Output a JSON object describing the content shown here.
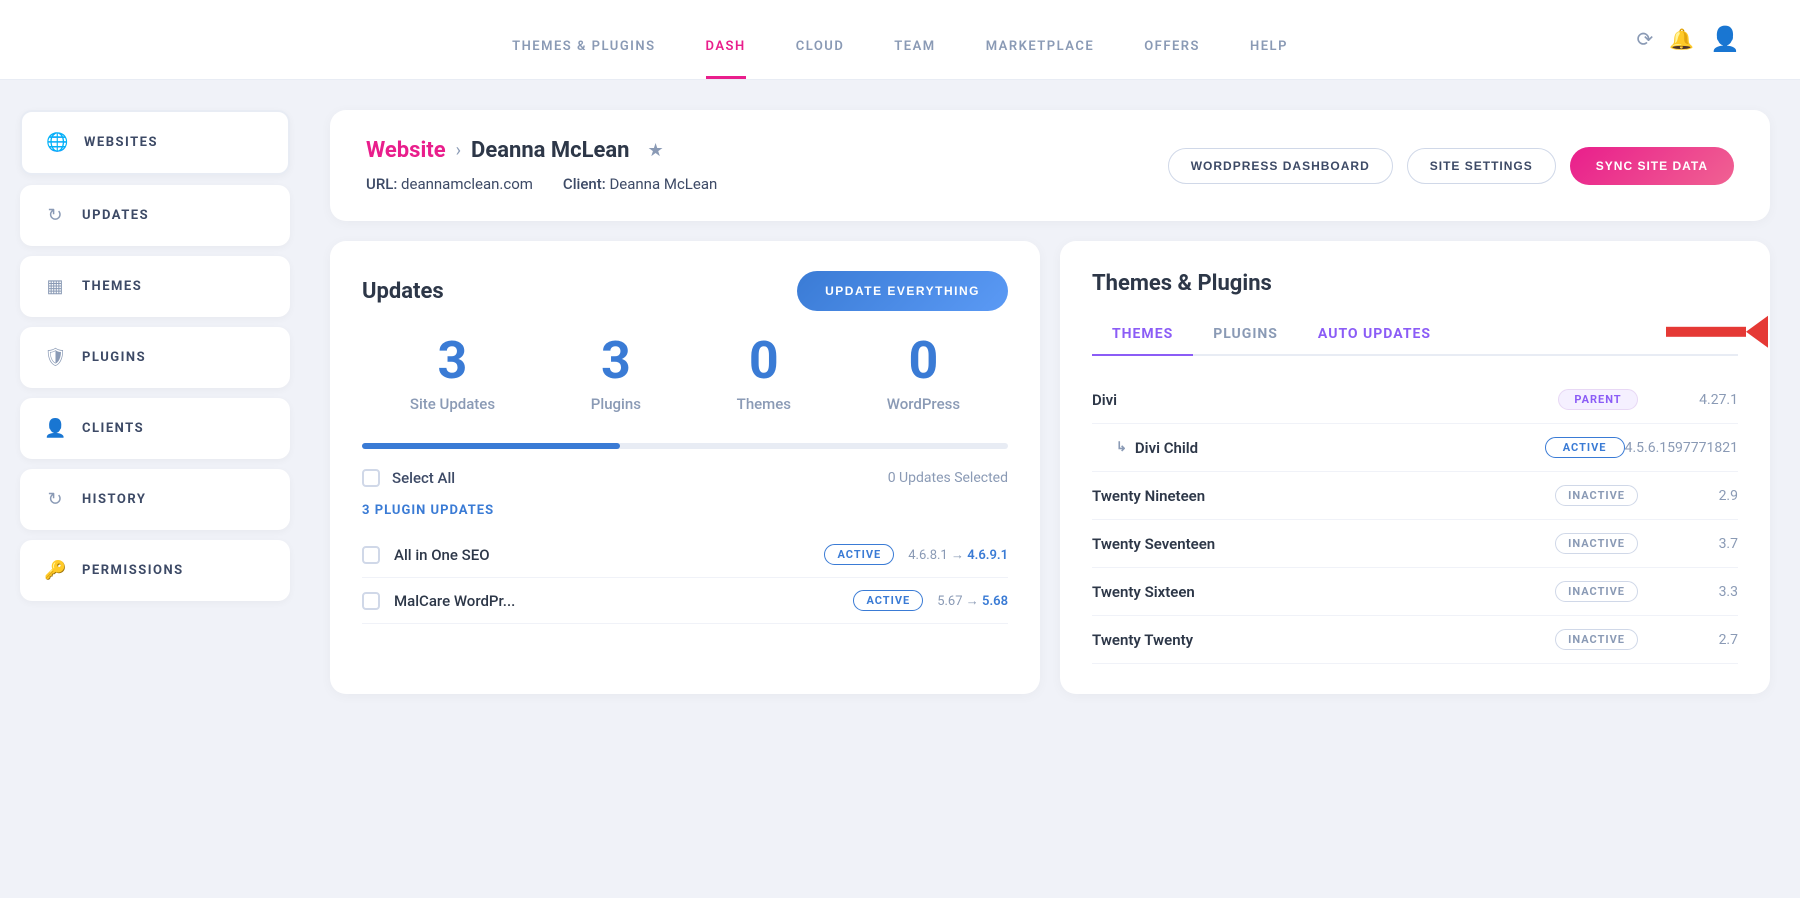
{
  "topNav": {
    "links": [
      {
        "id": "themes-plugins",
        "label": "THEMES & PLUGINS",
        "active": false
      },
      {
        "id": "dash",
        "label": "DASH",
        "active": true
      },
      {
        "id": "cloud",
        "label": "CLOUD",
        "active": false
      },
      {
        "id": "team",
        "label": "TEAM",
        "active": false
      },
      {
        "id": "marketplace",
        "label": "MARKETPLACE",
        "active": false
      },
      {
        "id": "offers",
        "label": "OFFERS",
        "active": false
      },
      {
        "id": "help",
        "label": "HELP",
        "active": false
      }
    ]
  },
  "sidebar": {
    "items": [
      {
        "id": "websites",
        "label": "WEBSITES",
        "icon": "🌐",
        "active": true
      },
      {
        "id": "updates",
        "label": "UPDATES",
        "icon": "↻",
        "active": false
      },
      {
        "id": "themes",
        "label": "THEMES",
        "icon": "▦",
        "active": false
      },
      {
        "id": "plugins",
        "label": "PLUGINS",
        "icon": "🛡",
        "active": false
      },
      {
        "id": "clients",
        "label": "CLIENTS",
        "icon": "👤",
        "active": false
      },
      {
        "id": "history",
        "label": "HISTORY",
        "icon": "↻",
        "active": false
      },
      {
        "id": "permissions",
        "label": "PERMISSIONS",
        "icon": "🔑",
        "active": false
      }
    ]
  },
  "siteHeader": {
    "breadcrumb_website": "Website",
    "breadcrumb_arrow": "›",
    "site_name": "Deanna McLean",
    "url_label": "URL:",
    "url_value": "deannamclean.com",
    "client_label": "Client:",
    "client_value": "Deanna McLean",
    "btn_wordpress": "WORDPRESS DASHBOARD",
    "btn_settings": "SITE SETTINGS",
    "btn_sync": "SYNC SITE DATA"
  },
  "updatesPanel": {
    "title": "Updates",
    "btn_update": "UPDATE EVERYTHING",
    "stats": [
      {
        "number": "3",
        "label": "Site Updates"
      },
      {
        "number": "3",
        "label": "Plugins"
      },
      {
        "number": "0",
        "label": "Themes"
      },
      {
        "number": "0",
        "label": "WordPress"
      }
    ],
    "select_all_label": "Select All",
    "updates_selected": "0 Updates Selected",
    "plugin_updates_label": "3 PLUGIN UPDATES",
    "plugins": [
      {
        "name": "All in One SEO",
        "badge": "ACTIVE",
        "version_from": "4.6.8.1",
        "version_to": "4.6.9.1"
      },
      {
        "name": "MalCare WordPr...",
        "badge": "ACTIVE",
        "version_from": "5.67",
        "version_to": "5.68"
      }
    ]
  },
  "themesPanel": {
    "title": "Themes & Plugins",
    "tabs": [
      {
        "id": "themes",
        "label": "THEMES",
        "active": true
      },
      {
        "id": "plugins",
        "label": "PLUGINS",
        "active": false
      },
      {
        "id": "auto-updates",
        "label": "AUTO UPDATES",
        "active": false
      }
    ],
    "themes": [
      {
        "name": "Divi",
        "badge": "PARENT",
        "badge_type": "parent",
        "version": "4.27.1",
        "indent": false
      },
      {
        "name": "Divi Child",
        "badge": "ACTIVE",
        "badge_type": "active",
        "version": "4.5.6.1597771821",
        "indent": true
      },
      {
        "name": "Twenty Nineteen",
        "badge": "INACTIVE",
        "badge_type": "inactive",
        "version": "2.9",
        "indent": false
      },
      {
        "name": "Twenty Seventeen",
        "badge": "INACTIVE",
        "badge_type": "inactive",
        "version": "3.7",
        "indent": false
      },
      {
        "name": "Twenty Sixteen",
        "badge": "INACTIVE",
        "badge_type": "inactive",
        "version": "3.3",
        "indent": false
      },
      {
        "name": "Twenty Twenty",
        "badge": "INACTIVE",
        "badge_type": "inactive",
        "version": "2.7",
        "indent": false
      }
    ]
  }
}
